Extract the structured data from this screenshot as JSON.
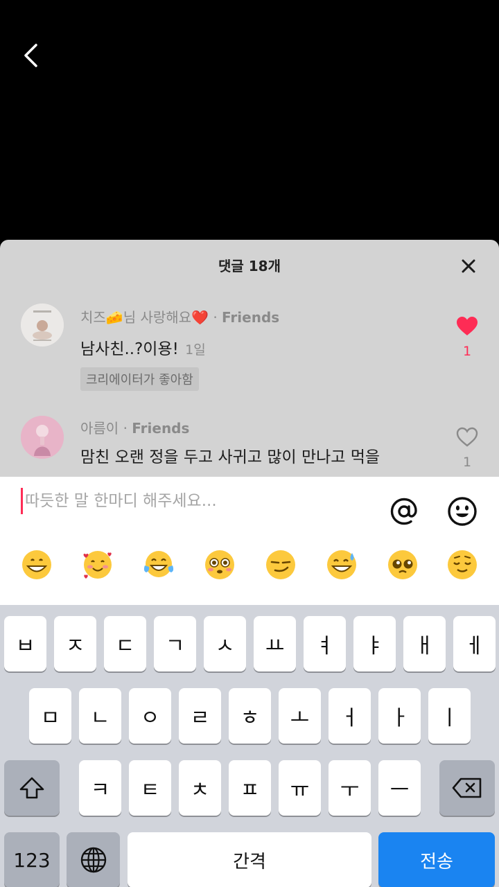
{
  "sheet": {
    "title": "댓글 18개"
  },
  "comments": [
    {
      "username": "치즈🧀님 사랑해요❤️",
      "relation": "Friends",
      "text": "남사친..?이용!",
      "age": "1일",
      "badge": "크리에이터가 좋아함",
      "likes": "1",
      "liked": true
    },
    {
      "username": "아름이",
      "relation": "Friends",
      "text": "맘친 오랜 정을 두고 사귀고 많이 만나고 먹을",
      "likes": "1",
      "liked": false
    }
  ],
  "input": {
    "placeholder": "따듯한 말 한마디 해주세요..."
  },
  "emojis": [
    "grinning-face",
    "smiling-face-with-hearts",
    "face-with-tears-of-joy",
    "flushed-face",
    "smirking-face",
    "grinning-face-with-sweat",
    "pleading-face",
    "relieved-face"
  ],
  "keyboard": {
    "row1": [
      "ㅂ",
      "ㅈ",
      "ㄷ",
      "ㄱ",
      "ㅅ",
      "ㅛ",
      "ㅕ",
      "ㅑ",
      "ㅐ",
      "ㅔ"
    ],
    "row2": [
      "ㅁ",
      "ㄴ",
      "ㅇ",
      "ㄹ",
      "ㅎ",
      "ㅗ",
      "ㅓ",
      "ㅏ",
      "ㅣ"
    ],
    "row3": [
      "ㅋ",
      "ㅌ",
      "ㅊ",
      "ㅍ",
      "ㅠ",
      "ㅜ",
      "ㅡ"
    ],
    "numbers_label": "123",
    "space_label": "간격",
    "send_label": "전송"
  },
  "colors": {
    "like_red": "#fe2c55",
    "send_blue": "#1a84f1"
  }
}
